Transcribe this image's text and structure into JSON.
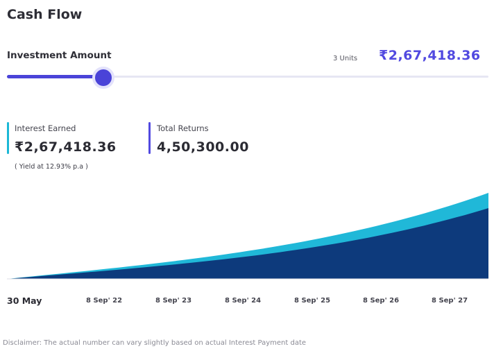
{
  "header": {
    "title": "Cash Flow"
  },
  "investment": {
    "label": "Investment Amount",
    "units": "3 Units",
    "amount": "₹2,67,418.36",
    "slider_fraction": 0.2
  },
  "stats": {
    "interest": {
      "label": "Interest Earned",
      "value": "₹2,67,418.36",
      "note": "( Yield at 12.93% p.a )",
      "color": "#1bb8d6"
    },
    "returns": {
      "label": "Total Returns",
      "value": "4,50,300.00",
      "color": "#5149e0"
    }
  },
  "chart": {
    "colors": {
      "interest": "#20b8d8",
      "principal": "#0d3a7c"
    },
    "x_labels": [
      "30 May",
      "8 Sep' 22",
      "8 Sep' 23",
      "8 Sep' 24",
      "8 Sep' 25",
      "8 Sep' 26",
      "8 Sep' 27"
    ]
  },
  "disclaimer": "Disclaimer: The actual number can vary slightly based on actual Interest Payment date"
}
